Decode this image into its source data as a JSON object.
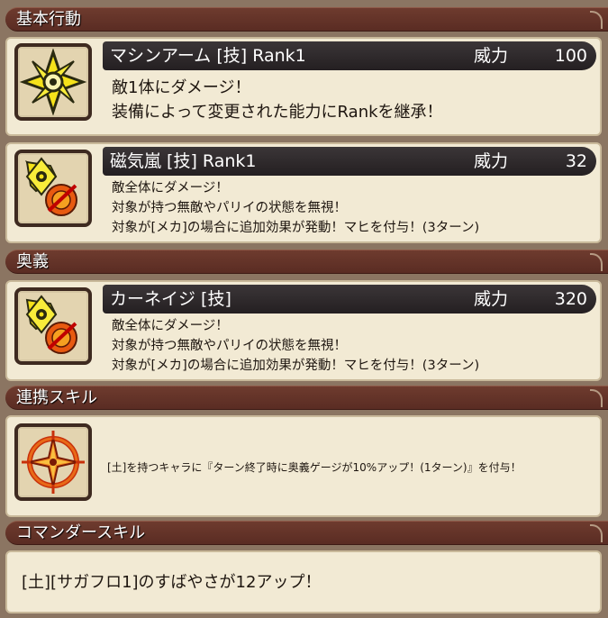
{
  "sections": {
    "basic": "基本行動",
    "ougi": "奥義",
    "link": "連携スキル",
    "commander": "コマンダースキル"
  },
  "skills": [
    {
      "name": "マシンアーム [技]   Rank1",
      "power_label": "威力",
      "power": "100",
      "desc": [
        "敵1体にダメージ！",
        "装備によって変更された能力にRankを継承！"
      ]
    },
    {
      "name": "磁気嵐 [技]   Rank1",
      "power_label": "威力",
      "power": "32",
      "desc": [
        "敵全体にダメージ！",
        "対象が持つ無敵やパリイの状態を無視！",
        "対象が[メカ]の場合に追加効果が発動！マヒを付与！(3ターン)"
      ]
    },
    {
      "name": "カーネイジ [技]",
      "power_label": "威力",
      "power": "320",
      "desc": [
        "敵全体にダメージ！",
        "対象が持つ無敵やパリイの状態を無視！",
        "対象が[メカ]の場合に追加効果が発動！マヒを付与！(3ターン)"
      ]
    }
  ],
  "link_skill": {
    "desc": "[土]を持つキャラに『ターン終了時に奥義ゲージが10%アップ！(1ターン)』を付与！"
  },
  "commander_skill": {
    "desc": "[土][サガフロ1]のすばやさが12アップ！"
  },
  "icons": {
    "skill1": "yellow-star-gear-icon",
    "skill2": "shuriken-shield-icon",
    "skill3": "shuriken-shield-icon",
    "link": "orange-compass-burst-icon"
  }
}
